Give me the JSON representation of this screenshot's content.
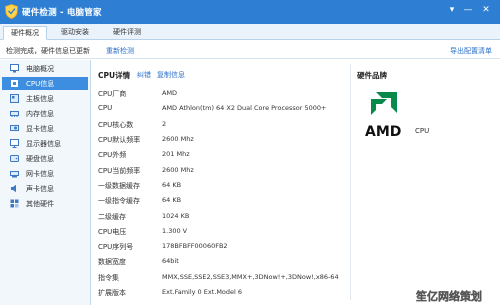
{
  "window": {
    "title": "硬件检测 - 电脑管家",
    "controls": {
      "menu": "▾",
      "minimize": "—",
      "close": "✕"
    }
  },
  "tabs": [
    {
      "label": "硬件概况",
      "active": true
    },
    {
      "label": "驱动安装",
      "active": false
    },
    {
      "label": "硬件评测",
      "active": false
    }
  ],
  "status": {
    "text": "检测完成，硬件信息已更新",
    "rescan_label": "重新检测",
    "export_label": "导出配置清单"
  },
  "sidebar": {
    "items": [
      {
        "label": "电脑概况",
        "icon": "computer-icon",
        "active": false
      },
      {
        "label": "CPU信息",
        "icon": "cpu-icon",
        "active": true
      },
      {
        "label": "主板信息",
        "icon": "motherboard-icon",
        "active": false
      },
      {
        "label": "内存信息",
        "icon": "memory-icon",
        "active": false
      },
      {
        "label": "显卡信息",
        "icon": "gpu-icon",
        "active": false
      },
      {
        "label": "显示器信息",
        "icon": "monitor-icon",
        "active": false
      },
      {
        "label": "硬盘信息",
        "icon": "disk-icon",
        "active": false
      },
      {
        "label": "网卡信息",
        "icon": "network-icon",
        "active": false
      },
      {
        "label": "声卡信息",
        "icon": "sound-icon",
        "active": false
      },
      {
        "label": "其他硬件",
        "icon": "other-hardware-icon",
        "active": false
      }
    ]
  },
  "cpu_detail": {
    "title": "CPU详情",
    "links": [
      "纠错",
      "复制信息"
    ],
    "rows": [
      {
        "label": "CPU厂商",
        "value": "AMD"
      },
      {
        "label": "CPU",
        "value": "AMD Athlon(tm) 64 X2 Dual Core Processor 5000+"
      },
      {
        "label": "CPU核心数",
        "value": "2"
      },
      {
        "label": "CPU默认频率",
        "value": "2600 Mhz"
      },
      {
        "label": "CPU外频",
        "value": "201 Mhz"
      },
      {
        "label": "CPU当前频率",
        "value": "2600 Mhz"
      },
      {
        "label": "一级数据缓存",
        "value": "64 KB"
      },
      {
        "label": "一级指令缓存",
        "value": "64 KB"
      },
      {
        "label": "二级缓存",
        "value": "1024 KB"
      },
      {
        "label": "CPU电压",
        "value": "1.300 V"
      },
      {
        "label": "CPU序列号",
        "value": "178BFBFF00060FB2"
      },
      {
        "label": "数据宽度",
        "value": "64bit"
      },
      {
        "label": "指令集",
        "value": "MMX,SSE,SSE2,SSE3,MMX+,3DNow!+,3DNow!,x86-64"
      },
      {
        "label": "扩展版本",
        "value": "Ext.Family 0  Ext.Model 6"
      }
    ]
  },
  "brand": {
    "title": "硬件品牌",
    "logo_text": "AMD",
    "cpu_label": "CPU"
  },
  "watermark": {
    "text": "笙亿网络策划"
  },
  "colors": {
    "titlebar": "#2e7fd3",
    "accent": "#3d8ee0",
    "link": "#2a6fc9",
    "amd_green": "#0a8a4a"
  }
}
